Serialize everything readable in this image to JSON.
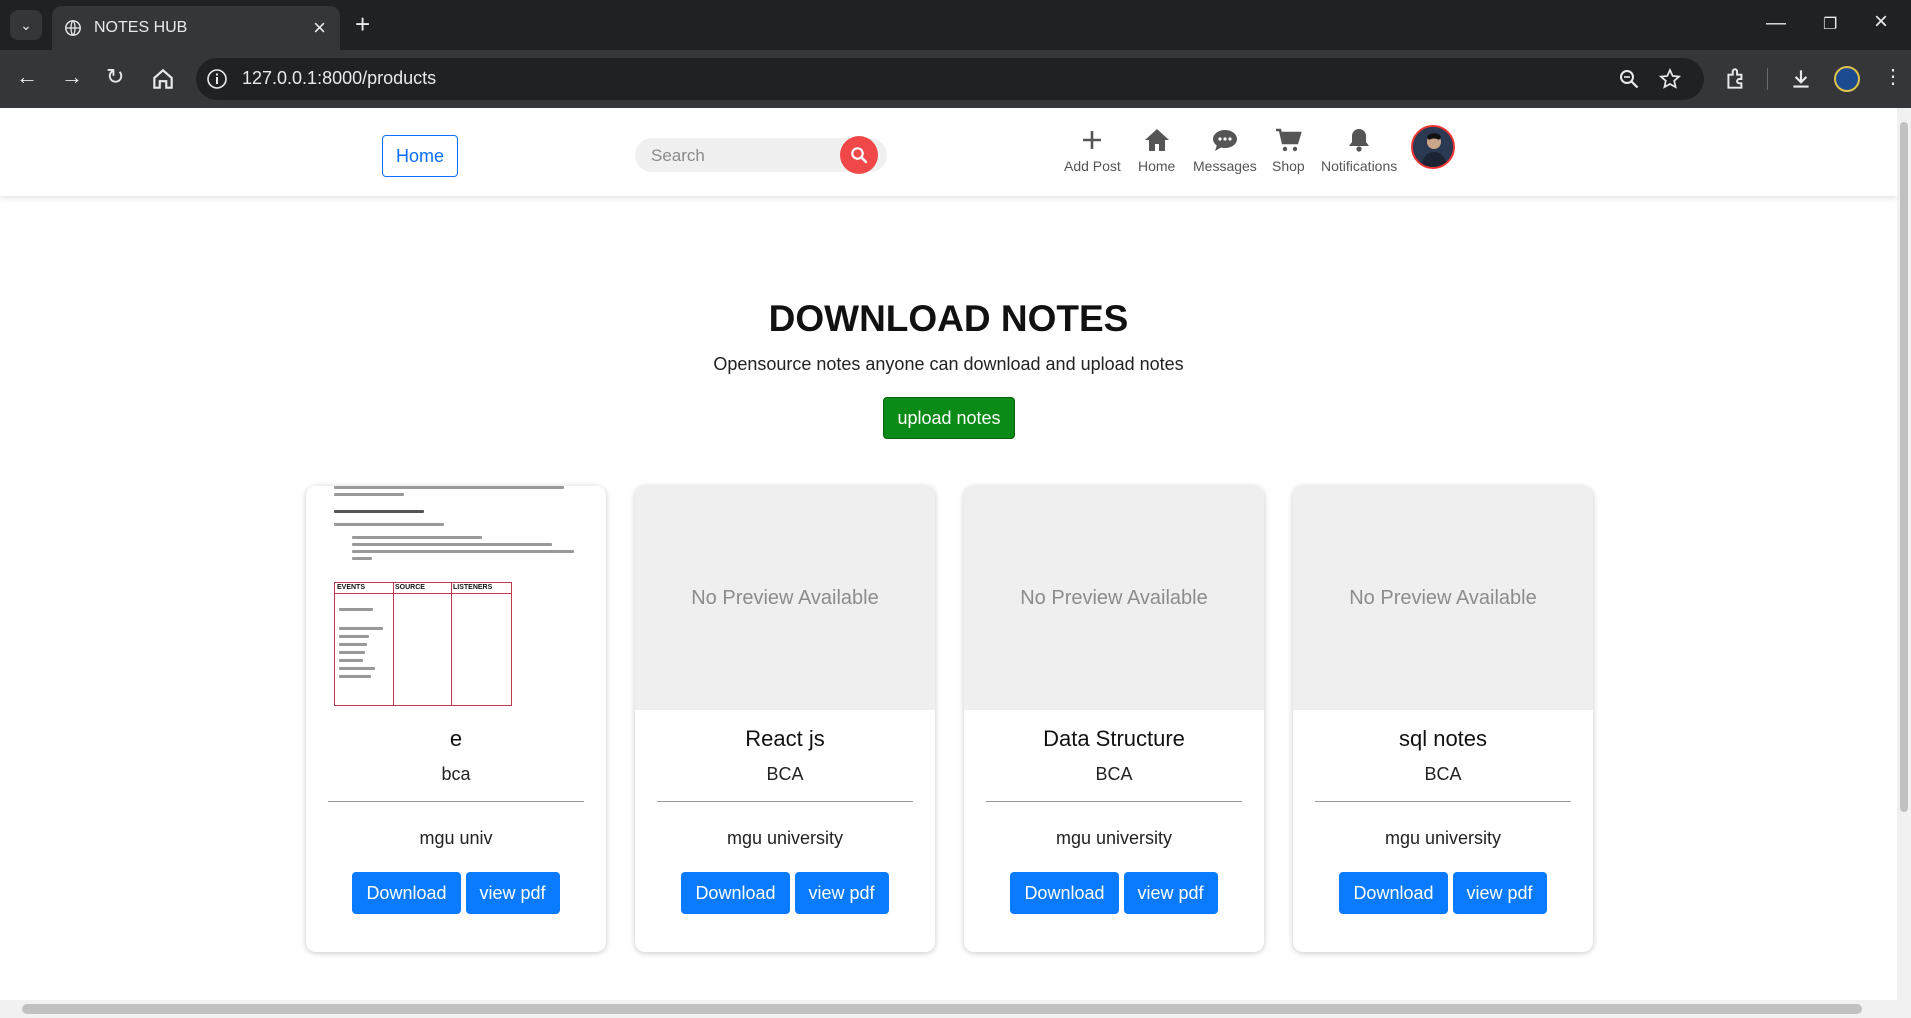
{
  "browser": {
    "tab_title": "NOTES HUB",
    "url": "127.0.0.1:8000/products"
  },
  "navbar": {
    "home_button": "Home",
    "search_placeholder": "Search",
    "items": [
      {
        "label": "Add Post",
        "icon": "plus-icon"
      },
      {
        "label": "Home",
        "icon": "home-icon"
      },
      {
        "label": "Messages",
        "icon": "chat-icon"
      },
      {
        "label": "Shop",
        "icon": "cart-icon"
      },
      {
        "label": "Notifications",
        "icon": "bell-icon"
      }
    ]
  },
  "hero": {
    "title": "DOWNLOAD NOTES",
    "subtitle": "Opensource notes anyone can download and upload notes",
    "upload_button": "upload notes"
  },
  "cards": [
    {
      "title": "e",
      "course": "bca",
      "university": "mgu univ",
      "preview": "",
      "download": "Download",
      "view": "view pdf"
    },
    {
      "title": "React js",
      "course": "BCA",
      "university": "mgu university",
      "preview": "No Preview Available",
      "download": "Download",
      "view": "view pdf"
    },
    {
      "title": "Data Structure",
      "course": "BCA",
      "university": "mgu university",
      "preview": "No Preview Available",
      "download": "Download",
      "view": "view pdf"
    },
    {
      "title": "sql notes",
      "course": "BCA",
      "university": "mgu university",
      "preview": "No Preview Available",
      "download": "Download",
      "view": "view pdf"
    }
  ],
  "preview_table_headers": [
    "EVENTS",
    "SOURCE",
    "LISTENERS"
  ],
  "colors": {
    "accent_blue": "#0a7bff",
    "upload_green": "#0a8a16",
    "search_red": "#f04848"
  }
}
